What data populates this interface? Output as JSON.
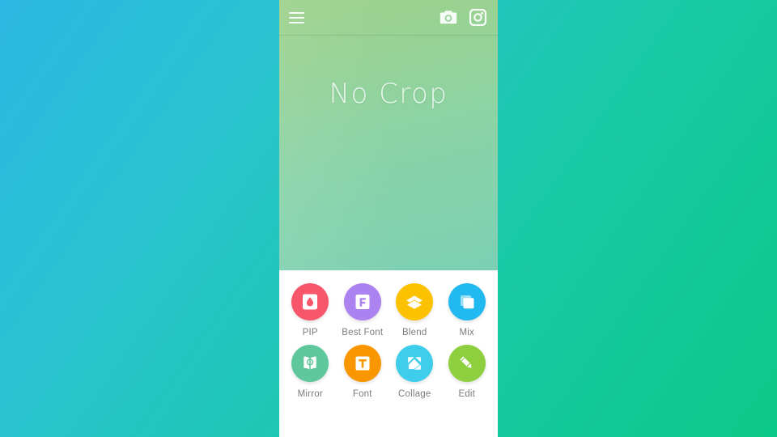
{
  "app": {
    "preview_label": "No Crop"
  },
  "topbar": {
    "menu_icon": "hamburger-menu-icon",
    "camera_icon": "camera-icon",
    "gallery_icon": "gallery-icon"
  },
  "colors": {
    "background_start": "#2bb8e4",
    "background_end": "#0bc987",
    "preview_start": "#9ed28b",
    "preview_end": "#7ccfb4",
    "panel": "#ffffff",
    "label": "#7c7c7c"
  },
  "tools": {
    "rows": [
      [
        {
          "label": "PIP",
          "color": "#f8566b",
          "icon": "pip-droplet-icon"
        },
        {
          "label": "Best Font",
          "color": "#ab82f0",
          "icon": "best-font-icon"
        },
        {
          "label": "Blend",
          "color": "#fcc200",
          "icon": "blend-layers-icon"
        },
        {
          "label": "Mix",
          "color": "#22b8f0",
          "icon": "mix-squares-icon"
        }
      ],
      [
        {
          "label": "Mirror",
          "color": "#5ec79b",
          "icon": "mirror-book-icon"
        },
        {
          "label": "Font",
          "color": "#fa9600",
          "icon": "font-t-icon"
        },
        {
          "label": "Collage",
          "color": "#3fcdec",
          "icon": "collage-grid-icon"
        },
        {
          "label": "Edit",
          "color": "#8dcf3f",
          "icon": "edit-pencil-icon"
        }
      ]
    ]
  }
}
